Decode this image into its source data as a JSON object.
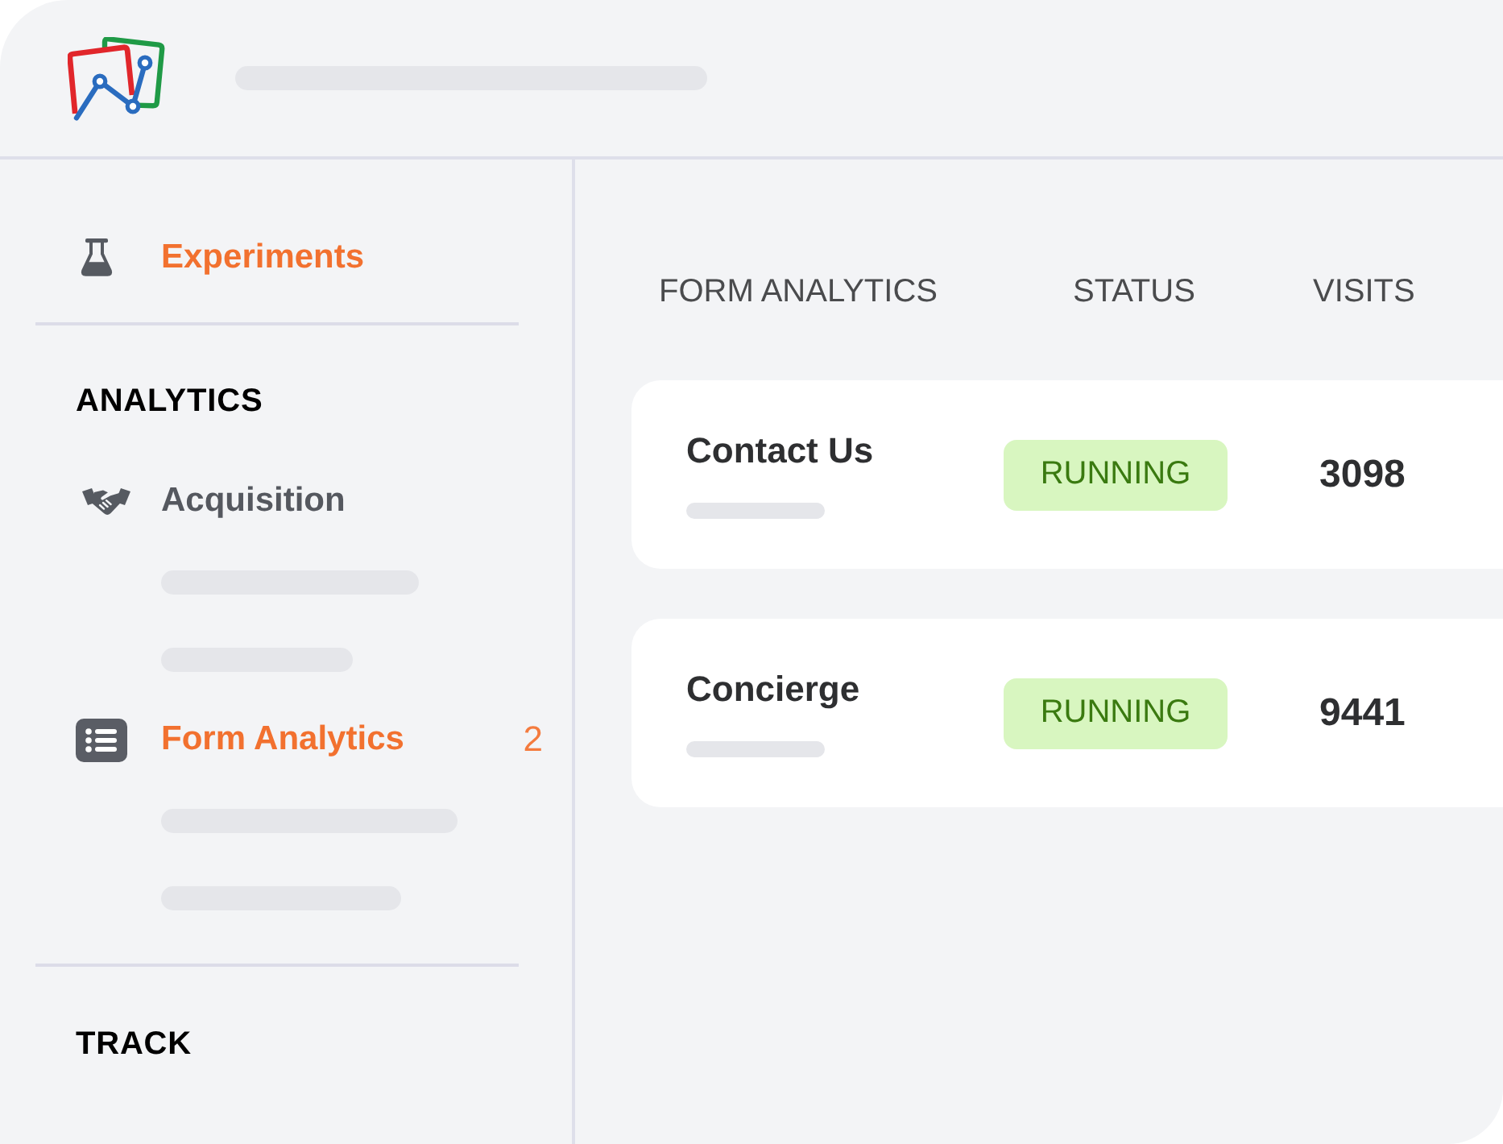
{
  "sidebar": {
    "sections": [
      {
        "items": [
          {
            "label": "Experiments",
            "selected": true
          }
        ]
      },
      {
        "heading": "ANALYTICS",
        "items": [
          {
            "label": "Acquisition",
            "selected": false
          },
          {
            "label": "Form Analytics",
            "selected": true,
            "count": "2"
          }
        ]
      },
      {
        "heading": "TRACK"
      }
    ]
  },
  "table": {
    "columns": [
      "FORM ANALYTICS",
      "STATUS",
      "VISITS"
    ],
    "rows": [
      {
        "name": "Contact Us",
        "status": "RUNNING",
        "visits": "3098"
      },
      {
        "name": "Concierge",
        "status": "RUNNING",
        "visits": "9441"
      }
    ]
  }
}
